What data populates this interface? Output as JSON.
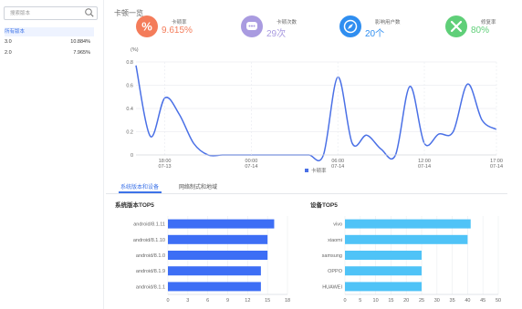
{
  "sidebar": {
    "search_placeholder": "搜索版本",
    "items": [
      {
        "label": "所有版本",
        "value": ""
      },
      {
        "label": "3.0",
        "value": "10.884%"
      },
      {
        "label": "2.0",
        "value": "7.965%"
      }
    ]
  },
  "overview": {
    "title": "卡顿一览",
    "stats": [
      {
        "label": "卡顿率",
        "value": "9.615%",
        "icon": "percent-icon",
        "color": "#f47c5a",
        "value_color": "#f47c5a"
      },
      {
        "label": "卡顿次数",
        "value": "29次",
        "icon": "chat-icon",
        "color": "#a99be0",
        "value_color": "#a99be0"
      },
      {
        "label": "影响用户数",
        "value": "20个",
        "icon": "compass-icon",
        "color": "#2f8ef0",
        "value_color": "#2f8ef0"
      },
      {
        "label": "修复率",
        "value": "80%",
        "icon": "tools-icon",
        "color": "#5fcf78",
        "value_color": "#5fcf78"
      }
    ]
  },
  "chart_data": [
    {
      "type": "line",
      "ylabel": "(%)",
      "ylim": [
        0,
        0.8
      ],
      "yticks": [
        "0",
        "0.2",
        "0.4",
        "0.6",
        "0.8"
      ],
      "xticks": [
        [
          "18:00",
          "07-13"
        ],
        [
          "00:00",
          "07-14"
        ],
        [
          "06:00",
          "07-14"
        ],
        [
          "12:00",
          "07-14"
        ],
        [
          "17:00",
          "07-14"
        ]
      ],
      "series": [
        {
          "name": "卡顿率",
          "color": "#4a70e6",
          "x": [
            "2021-07-13 16:00",
            "2021-07-13 17:00",
            "2021-07-13 18:00",
            "2021-07-13 19:00",
            "2021-07-13 20:00",
            "2021-07-13 21:00",
            "2021-07-13 22:00",
            "2021-07-13 23:00",
            "2021-07-14 00:00",
            "2021-07-14 01:00",
            "2021-07-14 02:00",
            "2021-07-14 03:00",
            "2021-07-14 04:00",
            "2021-07-14 05:00",
            "2021-07-14 06:00",
            "2021-07-14 07:00",
            "2021-07-14 08:00",
            "2021-07-14 09:00",
            "2021-07-14 10:00",
            "2021-07-14 11:00",
            "2021-07-14 12:00",
            "2021-07-14 13:00",
            "2021-07-14 14:00",
            "2021-07-14 15:00",
            "2021-07-14 16:00",
            "2021-07-14 17:00"
          ],
          "values": [
            0.77,
            0.16,
            0.49,
            0.35,
            0.1,
            0.0,
            0.0,
            0.0,
            0.0,
            0.0,
            0.0,
            0.0,
            0.0,
            0.0,
            0.67,
            0.1,
            0.17,
            0.05,
            0.0,
            0.59,
            0.1,
            0.18,
            0.2,
            0.61,
            0.3,
            0.22
          ]
        }
      ]
    },
    {
      "type": "bar",
      "title": "系统版本TOP5",
      "categories": [
        "android/8.1.11",
        "android/8.1.10",
        "android/8.1.0",
        "android/8.1.9",
        "android/8.1.1"
      ],
      "values": [
        16,
        15,
        15,
        14,
        14
      ],
      "xlim": [
        0,
        18
      ],
      "xticks": [
        "0",
        "3",
        "6",
        "9",
        "12",
        "15",
        "18"
      ],
      "color": "#3d6ef5"
    },
    {
      "type": "bar",
      "title": "设备TOP5",
      "categories": [
        "vivo",
        "xiaomi",
        "samsung",
        "OPPO",
        "HUAWEI"
      ],
      "values": [
        41,
        40,
        25,
        25,
        25
      ],
      "xlim": [
        0,
        50
      ],
      "xticks": [
        "0",
        "5",
        "10",
        "15",
        "20",
        "25",
        "30",
        "35",
        "40",
        "45",
        "50"
      ],
      "color": "#4fc3f7"
    }
  ],
  "tabs": [
    {
      "label": "系统版本和设备",
      "active": true
    },
    {
      "label": "网络制式和地域",
      "active": false
    }
  ]
}
